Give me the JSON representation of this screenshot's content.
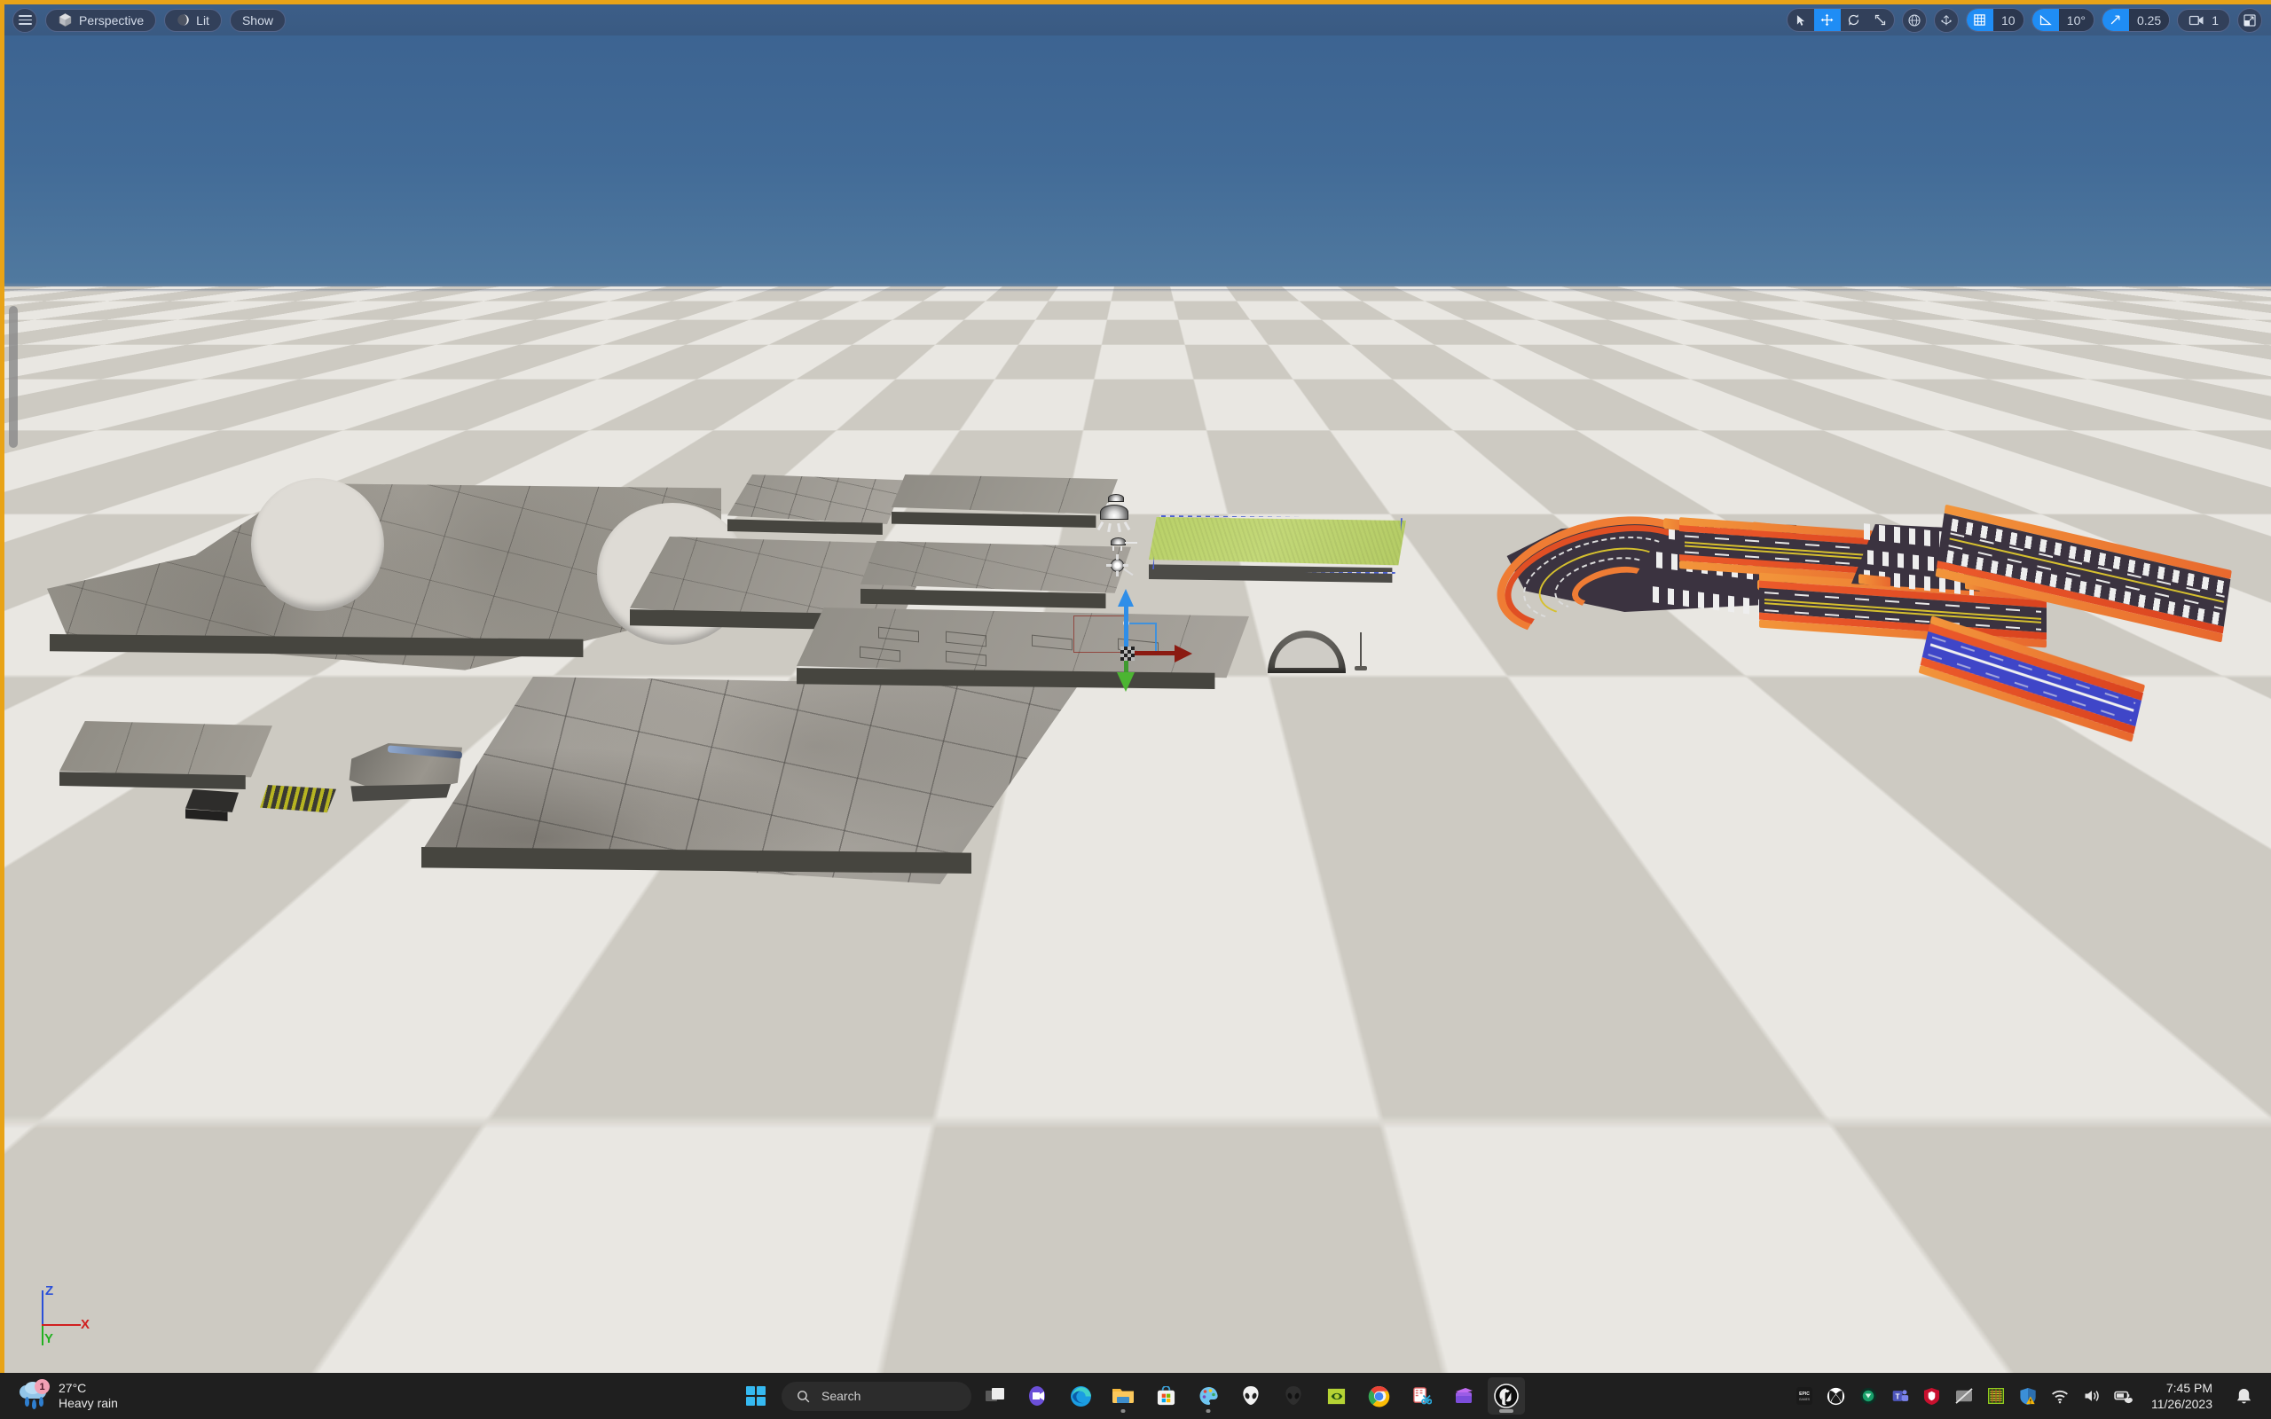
{
  "app": {
    "name": "Unreal Engine Level Editor Viewport",
    "active_viewport_border_color": "#e8a317"
  },
  "viewport_toolbar": {
    "menu_icon": "hamburger-menu-icon",
    "view_mode_button": {
      "label": "Perspective",
      "icon": "cube-icon"
    },
    "lighting_button": {
      "label": "Lit",
      "icon": "sphere-shading-icon"
    },
    "show_button": {
      "label": "Show"
    },
    "transform_tools": [
      {
        "name": "select",
        "icon": "cursor-arrow-icon",
        "active": false
      },
      {
        "name": "translate",
        "icon": "move-arrows-icon",
        "active": true
      },
      {
        "name": "rotate",
        "icon": "rotate-icon",
        "active": false
      },
      {
        "name": "scale",
        "icon": "scale-icon",
        "active": false
      }
    ],
    "coordinate_system": {
      "icon": "globe-icon",
      "label": "World"
    },
    "surface_snap": {
      "icon": "surface-snap-icon",
      "active": false
    },
    "grid_snap": {
      "icon": "grid-icon",
      "active": true,
      "value": "10"
    },
    "angle_snap": {
      "icon": "angle-icon",
      "active": true,
      "value": "10°"
    },
    "scale_snap": {
      "icon": "scale-snap-icon",
      "active": true,
      "value": "0.25"
    },
    "camera_speed": {
      "icon": "camera-icon",
      "value": "1"
    },
    "maximize": {
      "icon": "maximize-viewport-icon"
    }
  },
  "scene": {
    "sky_color": "#426b97",
    "ground_tile_light": "#e9e7e2",
    "ground_tile_dark": "#cdcac2",
    "selected_actor": "grass-plane",
    "gizmo": {
      "type": "translate",
      "axis_x_color": "#8b1b12",
      "axis_y_color": "#4cb532",
      "axis_z_color": "#2f8ee8"
    },
    "light_actors": [
      {
        "name": "directional-light-billboard"
      },
      {
        "name": "spot-light-billboard"
      },
      {
        "name": "point-light-billboard"
      }
    ],
    "meshes": [
      {
        "name": "concrete-t-junction-large",
        "material": "concrete"
      },
      {
        "name": "concrete-slab-small-a",
        "material": "concrete"
      },
      {
        "name": "concrete-slab-small-b",
        "material": "concrete"
      },
      {
        "name": "concrete-platform-large",
        "material": "concrete"
      },
      {
        "name": "concrete-strip-a",
        "material": "concrete"
      },
      {
        "name": "concrete-strip-b",
        "material": "concrete"
      },
      {
        "name": "concrete-strip-c",
        "material": "concrete"
      },
      {
        "name": "grass-plane",
        "material": "grass",
        "selected": true
      },
      {
        "name": "half-pipe-ramp",
        "material": "concrete"
      },
      {
        "name": "curved-barrier",
        "material": "concrete"
      },
      {
        "name": "small-block",
        "material": "dark"
      },
      {
        "name": "striped-wedge",
        "material": "hazard"
      },
      {
        "name": "racetrack-u-turn",
        "material": "asphalt-curb"
      },
      {
        "name": "racetrack-straight-a",
        "material": "asphalt-curb"
      },
      {
        "name": "racetrack-straight-b",
        "material": "asphalt-curb"
      },
      {
        "name": "racetrack-crosswalk-tile",
        "material": "asphalt-curb"
      },
      {
        "name": "racetrack-start-straight",
        "material": "asphalt-curb"
      },
      {
        "name": "racetrack-blue-straight",
        "material": "asphalt-blue"
      }
    ]
  },
  "axis_indicator": {
    "z": "Z",
    "x": "X",
    "y": "Y"
  },
  "taskbar": {
    "weather": {
      "temperature": "27°C",
      "condition": "Heavy rain",
      "badge": "1",
      "icon": "rain-cloud-icon"
    },
    "start": {
      "icon": "windows-logo-icon"
    },
    "search": {
      "placeholder": "Search",
      "icon": "search-icon"
    },
    "apps": [
      {
        "name": "task-view",
        "icon": "task-view-icon",
        "running": false
      },
      {
        "name": "zoom",
        "icon": "zoom-icon",
        "running": false
      },
      {
        "name": "microsoft-edge",
        "icon": "edge-icon",
        "running": false
      },
      {
        "name": "file-explorer",
        "icon": "folder-icon",
        "running": true
      },
      {
        "name": "microsoft-store",
        "icon": "store-icon",
        "running": false
      },
      {
        "name": "paint",
        "icon": "paint-palette-icon",
        "running": true
      },
      {
        "name": "alienware-command-center",
        "icon": "alien-head-icon",
        "running": false
      },
      {
        "name": "alienware-dark",
        "icon": "alien-head-dark-icon",
        "running": false
      },
      {
        "name": "nvidia-app",
        "icon": "nvidia-eye-icon",
        "running": false
      },
      {
        "name": "google-chrome",
        "icon": "chrome-icon",
        "running": false
      },
      {
        "name": "snipping-tool",
        "icon": "scissors-icon",
        "running": false
      },
      {
        "name": "clipchamp",
        "icon": "clipchamp-icon",
        "running": false
      },
      {
        "name": "unreal-engine",
        "icon": "unreal-engine-icon",
        "running": true
      }
    ],
    "tray": [
      {
        "name": "epic-games",
        "icon": "epic-games-icon"
      },
      {
        "name": "xbox",
        "icon": "xbox-icon"
      },
      {
        "name": "steam-downloader",
        "icon": "green-circle-icon"
      },
      {
        "name": "microsoft-teams",
        "icon": "teams-icon"
      },
      {
        "name": "mcafee",
        "icon": "mcafee-shield-icon"
      },
      {
        "name": "touchpad-off",
        "icon": "touchpad-disabled-icon"
      },
      {
        "name": "equalizer",
        "icon": "equalizer-icon"
      },
      {
        "name": "windows-security",
        "icon": "security-shield-warning-icon"
      },
      {
        "name": "network",
        "icon": "wifi-icon"
      },
      {
        "name": "volume",
        "icon": "speaker-icon"
      },
      {
        "name": "battery",
        "icon": "battery-saver-icon"
      }
    ],
    "clock": {
      "time": "7:45 PM",
      "date": "11/26/2023"
    },
    "notifications": {
      "icon": "bell-icon"
    }
  }
}
